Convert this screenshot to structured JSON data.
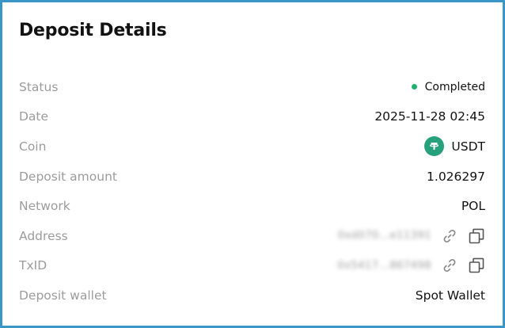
{
  "panel": {
    "title": "Deposit Details"
  },
  "status": {
    "label": "Status",
    "value": "Completed",
    "color": "#20b26c"
  },
  "date": {
    "label": "Date",
    "value": "2025-11-28 02:45"
  },
  "coin": {
    "label": "Coin",
    "value": "USDT",
    "icon": "tether-icon",
    "color": "#26a17b"
  },
  "amount": {
    "label": "Deposit amount",
    "value": "1.026297"
  },
  "network": {
    "label": "Network",
    "value": "POL"
  },
  "address": {
    "label": "Address",
    "value": "0xd070...e11391",
    "icons": [
      "link-icon",
      "copy-icon"
    ]
  },
  "txid": {
    "label": "TxID",
    "value": "0x5417...867498",
    "icons": [
      "link-icon",
      "copy-icon"
    ]
  },
  "wallet": {
    "label": "Deposit wallet",
    "value": "Spot Wallet"
  },
  "colors": {
    "border": "#3b96c8",
    "label": "#9c9c9c",
    "text": "#121212"
  }
}
